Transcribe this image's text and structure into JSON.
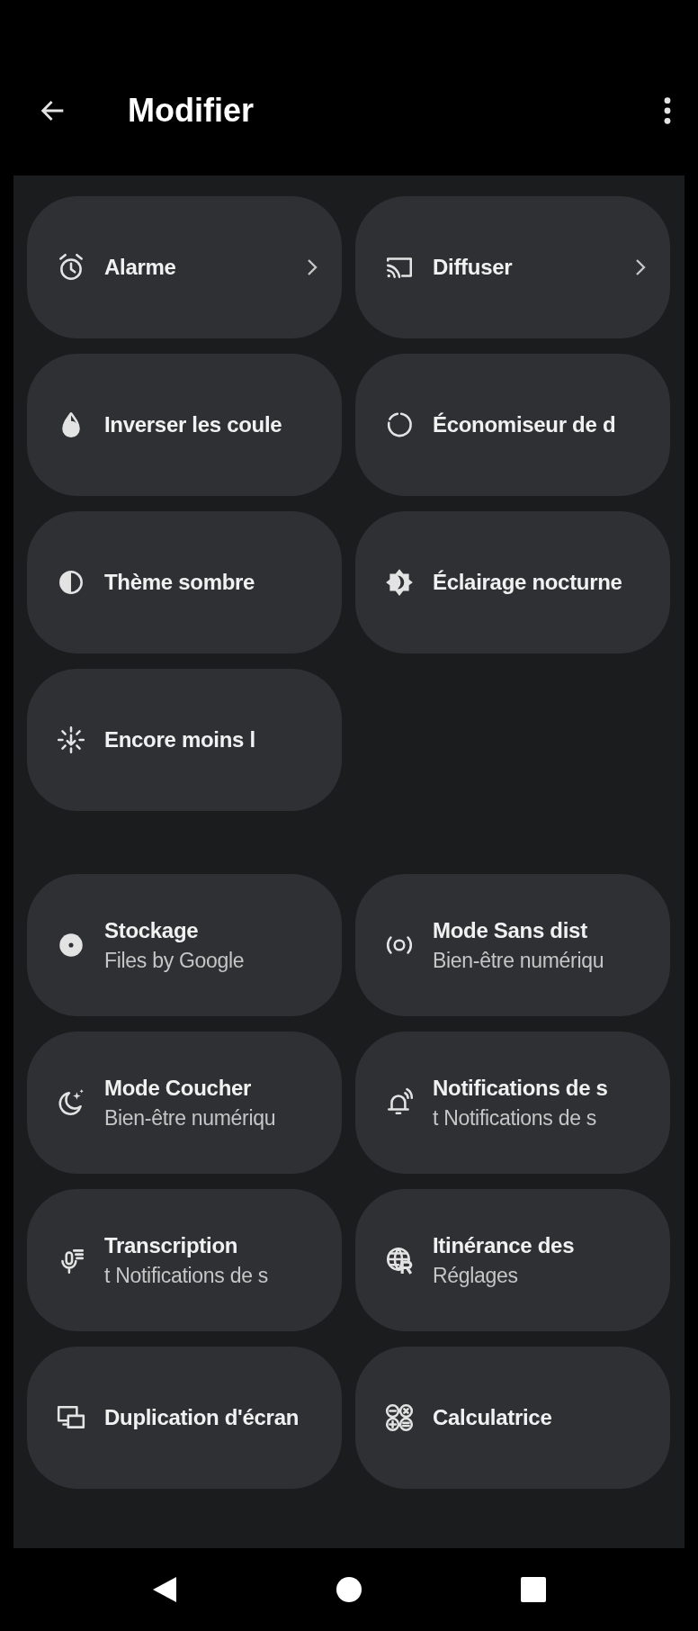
{
  "app_bar": {
    "title": "Modifier"
  },
  "active_tiles": [
    {
      "label": "Alarme",
      "chevron": true
    },
    {
      "label": "Diffuser",
      "chevron": true
    },
    {
      "label": "Inverser les coule",
      "chevron": false
    },
    {
      "label": "Économiseur de d",
      "chevron": false
    },
    {
      "label": "Thème sombre",
      "chevron": false
    },
    {
      "label": "Éclairage nocturne",
      "chevron": false
    },
    {
      "label": "Encore moins l",
      "chevron": false
    }
  ],
  "available_tiles": [
    {
      "label": "Stockage",
      "subtitle": "Files by Google"
    },
    {
      "label": "Mode Sans dist",
      "subtitle": "Bien-être numériqu"
    },
    {
      "label": "Mode Coucher",
      "subtitle": "Bien-être numériqu"
    },
    {
      "label": "Notifications de s",
      "subtitle": "t Notifications de s"
    },
    {
      "label": "Transcription",
      "subtitle": "t Notifications de s"
    },
    {
      "label": "Itinérance des",
      "subtitle": "Réglages"
    },
    {
      "label": "Duplication d'écran"
    },
    {
      "label": "Calculatrice"
    }
  ]
}
